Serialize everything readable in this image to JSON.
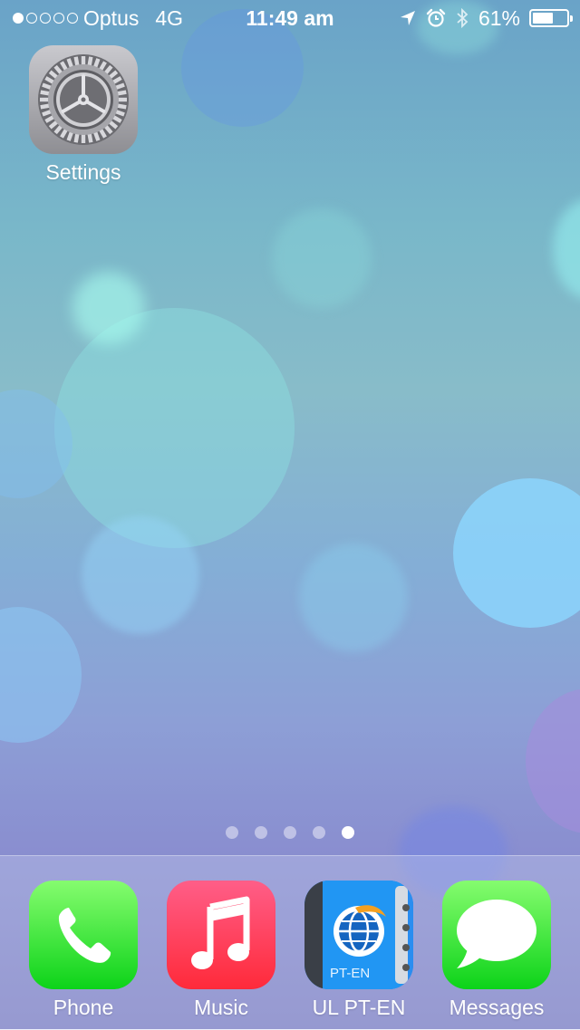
{
  "status_bar": {
    "signal_filled": 1,
    "signal_total": 5,
    "carrier": "Optus",
    "network": "4G",
    "time": "11:49 am",
    "battery_text": "61%",
    "battery_level": 0.61,
    "icons": [
      "location-arrow-icon",
      "alarm-clock-icon",
      "bluetooth-icon",
      "battery-icon"
    ]
  },
  "home": {
    "apps": [
      {
        "label": "Settings",
        "icon": "gear-icon"
      }
    ],
    "page_count": 5,
    "current_page": 5
  },
  "dock": {
    "apps": [
      {
        "label": "Phone",
        "icon": "phone-handset-icon",
        "color": "#2bd34c"
      },
      {
        "label": "Music",
        "icon": "music-note-icon",
        "color": "#fc3158"
      },
      {
        "label": "UL PT-EN",
        "icon": "globe-dictionary-icon",
        "badge_text": "PT-EN",
        "color": "#1e88e5"
      },
      {
        "label": "Messages",
        "icon": "speech-bubble-icon",
        "color": "#2bd34c"
      }
    ]
  }
}
